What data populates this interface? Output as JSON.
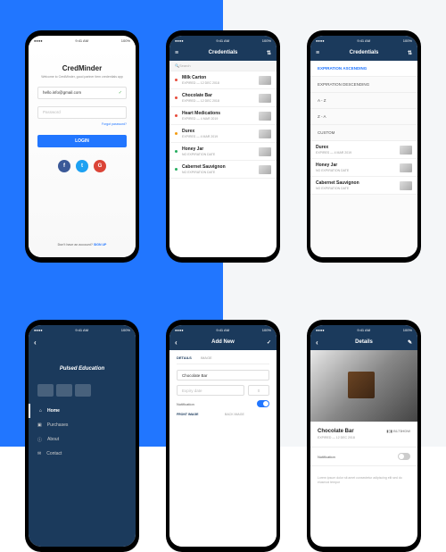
{
  "status_bar": {
    "time": "9:41 AM",
    "battery": "100%"
  },
  "login": {
    "app_name": "CredMinder",
    "tagline": "Welcome to CredMinder, good partner item credentials app",
    "email": "hello.info@gmail.com",
    "password_ph": "Password",
    "forgot": "Forgot password?",
    "login_btn": "LOGIN",
    "signup_prompt": "Don't have an account?",
    "signup": "SIGN UP"
  },
  "credentials": {
    "title": "Credentials",
    "search_ph": "Search",
    "items": [
      {
        "name": "Milk Carton",
        "status": "EXPIRED — 12 DEC 2018"
      },
      {
        "name": "Chocolate Bar",
        "status": "EXPIRED — 12 DEC 2018"
      },
      {
        "name": "Heart Medications",
        "status": "EXPIRED — 4 MAR 2019"
      },
      {
        "name": "Durex",
        "status": "EXPIRES — 4 MAR 2019"
      },
      {
        "name": "Honey Jar",
        "status": "NO EXPIRATION DATE"
      },
      {
        "name": "Cabernet Sauvignon",
        "status": "NO EXPIRATION DATE"
      }
    ]
  },
  "filter": {
    "title": "Credentials",
    "opts": [
      "EXPIRATION ASCENDING",
      "EXPIRATION DESCENDING",
      "A - Z",
      "Z - A",
      "CUSTOM"
    ],
    "items": [
      {
        "name": "Durex",
        "status": "EXPIRES — 4 MAR 2019"
      },
      {
        "name": "Honey Jar",
        "status": "NO EXPIRATION DATE"
      },
      {
        "name": "Cabernet Sauvignon",
        "status": "NO EXPIRATION DATE"
      }
    ]
  },
  "drawer": {
    "brand": "Pulsed Education",
    "items": [
      "Home",
      "Purchases",
      "About",
      "Contact"
    ]
  },
  "addnew": {
    "title": "Add New",
    "tabs": [
      "DETAILS",
      "IMAGE"
    ],
    "name": "Chocolate Bar",
    "exp_ph": "Expiry date",
    "qty_ph": "0",
    "notif": "Notification",
    "front": "FRONT IMAGE",
    "back": "BACK IMAGE"
  },
  "details": {
    "title": "Details",
    "name": "Chocolate Bar",
    "status": "EXPIRED — 12 DEC 2018",
    "code": "B173HDW",
    "notif": "Notification",
    "lorem": "Lorem ipsum dolor sit amet consectetur adipiscing elit sed do eiusmod tempor"
  }
}
